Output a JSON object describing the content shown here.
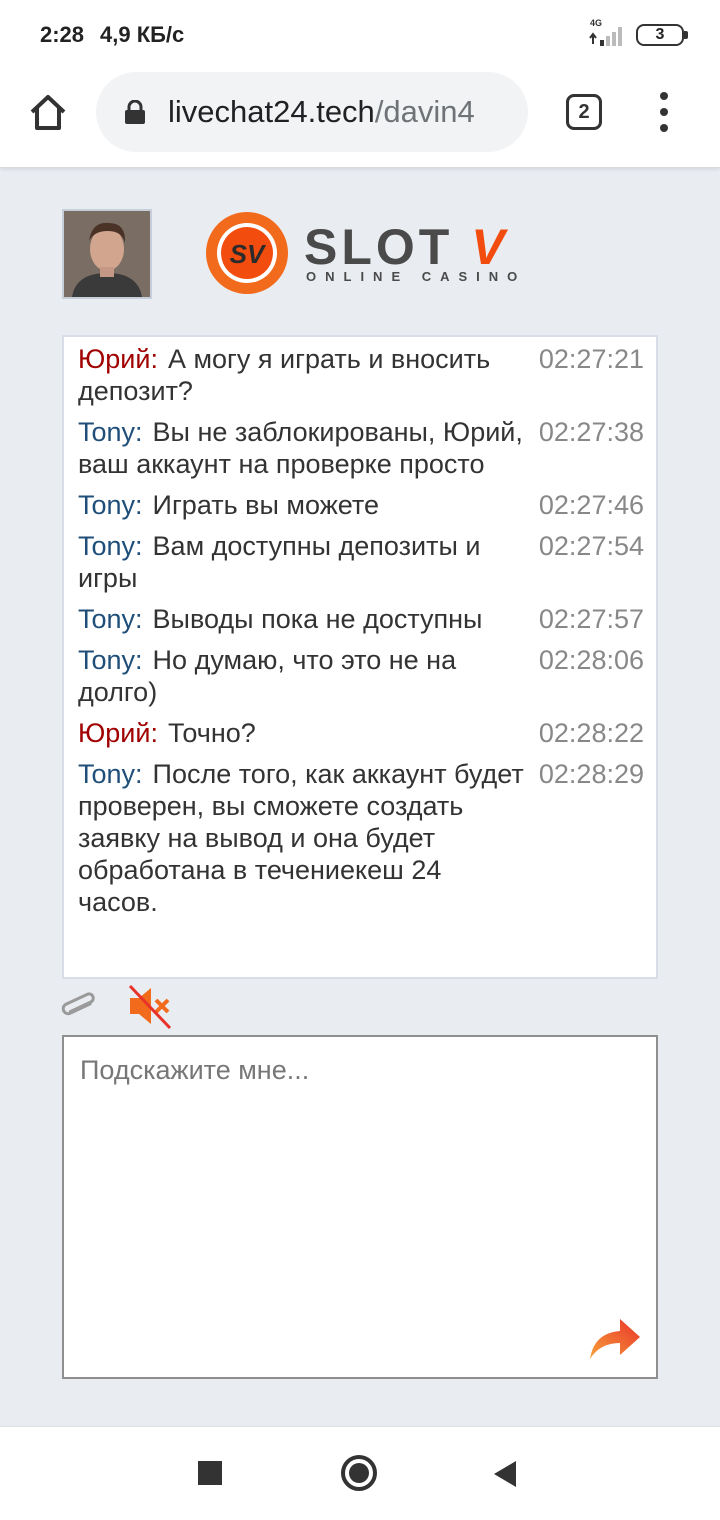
{
  "status_bar": {
    "time": "2:28",
    "speed": "4,9 КБ/с",
    "network": "4G",
    "battery": "3"
  },
  "browser": {
    "url_host": "livechat24.tech",
    "url_path": "/davin4",
    "tab_count": "2",
    "home_icon": "home-icon",
    "lock_icon": "lock-icon",
    "menu_icon": "more-vert-icon"
  },
  "header": {
    "logo_badge": "SV",
    "logo_brand": "SLOT",
    "logo_brand_v": "V",
    "logo_sub": "ONLINE CASINO"
  },
  "messages": [
    {
      "author": "Юрий:",
      "kind": "yuri",
      "text": "А могу я играть и вносить депозит?",
      "time": "02:27:21"
    },
    {
      "author": "Tony:",
      "kind": "tony",
      "text": "Вы не заблокированы, Юрий, ваш аккаунт на проверке просто",
      "time": "02:27:38"
    },
    {
      "author": "Tony:",
      "kind": "tony",
      "text": "Играть вы можете",
      "time": "02:27:46"
    },
    {
      "author": "Tony:",
      "kind": "tony",
      "text": "Вам доступны депозиты и игры",
      "time": "02:27:54"
    },
    {
      "author": "Tony:",
      "kind": "tony",
      "text": "Выводы пока не доступны",
      "time": "02:27:57"
    },
    {
      "author": "Tony:",
      "kind": "tony",
      "text": "Но думаю, что это не на долго)",
      "time": "02:28:06"
    },
    {
      "author": "Юрий:",
      "kind": "yuri",
      "text": "Точно?",
      "time": "02:28:22"
    },
    {
      "author": "Tony:",
      "kind": "tony",
      "text": "После того, как аккаунт будет проверен, вы сможете создать заявку на вывод и она будет обработана в течениекеш 24 часов.",
      "time": "02:28:29"
    }
  ],
  "input": {
    "placeholder": "Подскажите мне..."
  },
  "colors": {
    "yuri": "#a00000",
    "tony": "#1f4e79",
    "accent": "#f24d0f",
    "background": "#e9edf2"
  }
}
